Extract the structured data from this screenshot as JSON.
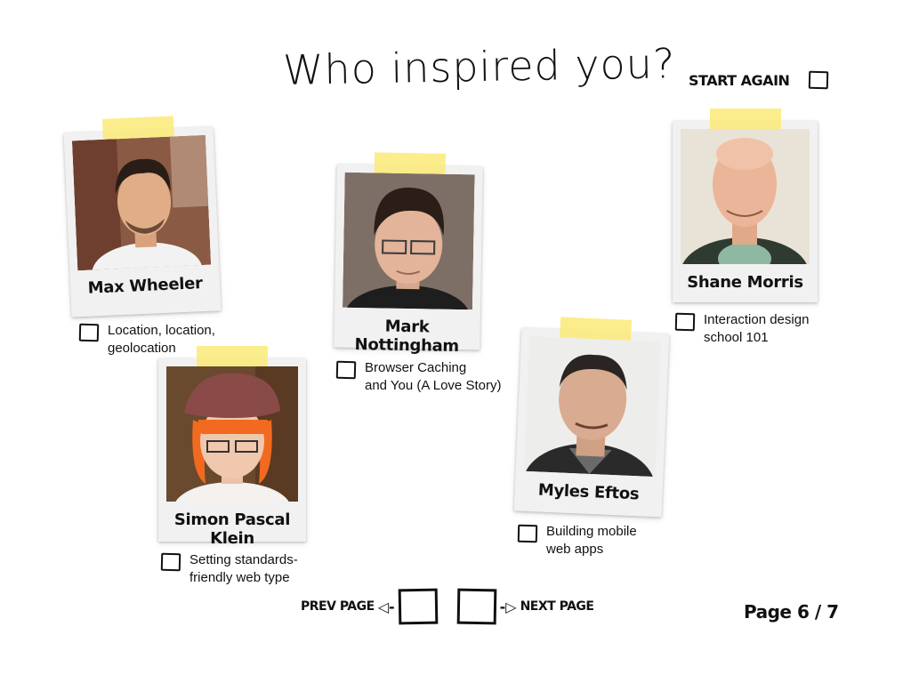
{
  "title": "Who inspired you?",
  "start_again": {
    "label": "START AGAIN"
  },
  "speakers": [
    {
      "name": "Max Wheeler",
      "talk": "Location, location,\ngeolocation"
    },
    {
      "name": "Mark Nottingham",
      "talk": "Browser Caching\nand You (A Love Story)"
    },
    {
      "name": "Shane Morris",
      "talk": "Interaction design\nschool 101"
    },
    {
      "name": "Simon Pascal Klein",
      "talk": "Setting standards-\nfriendly web type"
    },
    {
      "name": "Myles Eftos",
      "talk": "Building mobile\nweb apps"
    }
  ],
  "pager": {
    "prev_label": "PREV PAGE",
    "next_label": "NEXT PAGE",
    "prev_arrow": "◁-",
    "next_arrow": "-▷",
    "page_text": "Page 6 / 7"
  },
  "colors": {
    "tape": "#fce978",
    "polaroid": "#f1f1f1",
    "ink": "#111111"
  }
}
